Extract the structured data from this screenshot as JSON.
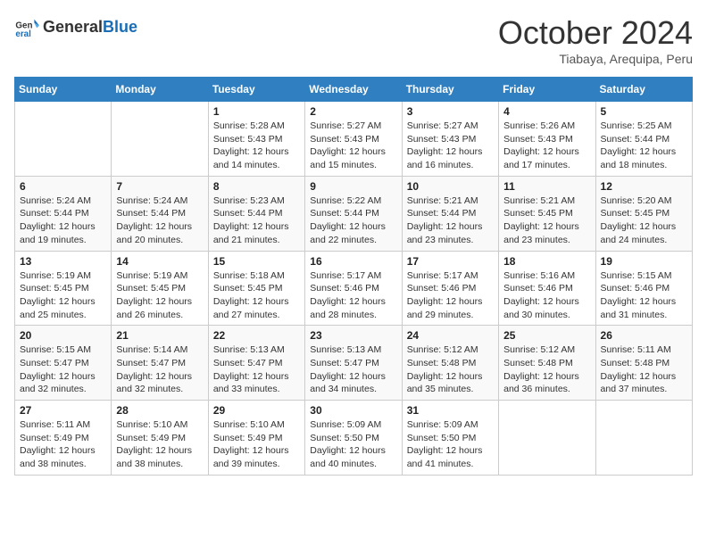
{
  "header": {
    "logo_general": "General",
    "logo_blue": "Blue",
    "title": "October 2024",
    "location": "Tiabaya, Arequipa, Peru"
  },
  "days_of_week": [
    "Sunday",
    "Monday",
    "Tuesday",
    "Wednesday",
    "Thursday",
    "Friday",
    "Saturday"
  ],
  "weeks": [
    [
      {
        "day": "",
        "info": ""
      },
      {
        "day": "",
        "info": ""
      },
      {
        "day": "1",
        "info": "Sunrise: 5:28 AM\nSunset: 5:43 PM\nDaylight: 12 hours and 14 minutes."
      },
      {
        "day": "2",
        "info": "Sunrise: 5:27 AM\nSunset: 5:43 PM\nDaylight: 12 hours and 15 minutes."
      },
      {
        "day": "3",
        "info": "Sunrise: 5:27 AM\nSunset: 5:43 PM\nDaylight: 12 hours and 16 minutes."
      },
      {
        "day": "4",
        "info": "Sunrise: 5:26 AM\nSunset: 5:43 PM\nDaylight: 12 hours and 17 minutes."
      },
      {
        "day": "5",
        "info": "Sunrise: 5:25 AM\nSunset: 5:44 PM\nDaylight: 12 hours and 18 minutes."
      }
    ],
    [
      {
        "day": "6",
        "info": "Sunrise: 5:24 AM\nSunset: 5:44 PM\nDaylight: 12 hours and 19 minutes."
      },
      {
        "day": "7",
        "info": "Sunrise: 5:24 AM\nSunset: 5:44 PM\nDaylight: 12 hours and 20 minutes."
      },
      {
        "day": "8",
        "info": "Sunrise: 5:23 AM\nSunset: 5:44 PM\nDaylight: 12 hours and 21 minutes."
      },
      {
        "day": "9",
        "info": "Sunrise: 5:22 AM\nSunset: 5:44 PM\nDaylight: 12 hours and 22 minutes."
      },
      {
        "day": "10",
        "info": "Sunrise: 5:21 AM\nSunset: 5:44 PM\nDaylight: 12 hours and 23 minutes."
      },
      {
        "day": "11",
        "info": "Sunrise: 5:21 AM\nSunset: 5:45 PM\nDaylight: 12 hours and 23 minutes."
      },
      {
        "day": "12",
        "info": "Sunrise: 5:20 AM\nSunset: 5:45 PM\nDaylight: 12 hours and 24 minutes."
      }
    ],
    [
      {
        "day": "13",
        "info": "Sunrise: 5:19 AM\nSunset: 5:45 PM\nDaylight: 12 hours and 25 minutes."
      },
      {
        "day": "14",
        "info": "Sunrise: 5:19 AM\nSunset: 5:45 PM\nDaylight: 12 hours and 26 minutes."
      },
      {
        "day": "15",
        "info": "Sunrise: 5:18 AM\nSunset: 5:45 PM\nDaylight: 12 hours and 27 minutes."
      },
      {
        "day": "16",
        "info": "Sunrise: 5:17 AM\nSunset: 5:46 PM\nDaylight: 12 hours and 28 minutes."
      },
      {
        "day": "17",
        "info": "Sunrise: 5:17 AM\nSunset: 5:46 PM\nDaylight: 12 hours and 29 minutes."
      },
      {
        "day": "18",
        "info": "Sunrise: 5:16 AM\nSunset: 5:46 PM\nDaylight: 12 hours and 30 minutes."
      },
      {
        "day": "19",
        "info": "Sunrise: 5:15 AM\nSunset: 5:46 PM\nDaylight: 12 hours and 31 minutes."
      }
    ],
    [
      {
        "day": "20",
        "info": "Sunrise: 5:15 AM\nSunset: 5:47 PM\nDaylight: 12 hours and 32 minutes."
      },
      {
        "day": "21",
        "info": "Sunrise: 5:14 AM\nSunset: 5:47 PM\nDaylight: 12 hours and 32 minutes."
      },
      {
        "day": "22",
        "info": "Sunrise: 5:13 AM\nSunset: 5:47 PM\nDaylight: 12 hours and 33 minutes."
      },
      {
        "day": "23",
        "info": "Sunrise: 5:13 AM\nSunset: 5:47 PM\nDaylight: 12 hours and 34 minutes."
      },
      {
        "day": "24",
        "info": "Sunrise: 5:12 AM\nSunset: 5:48 PM\nDaylight: 12 hours and 35 minutes."
      },
      {
        "day": "25",
        "info": "Sunrise: 5:12 AM\nSunset: 5:48 PM\nDaylight: 12 hours and 36 minutes."
      },
      {
        "day": "26",
        "info": "Sunrise: 5:11 AM\nSunset: 5:48 PM\nDaylight: 12 hours and 37 minutes."
      }
    ],
    [
      {
        "day": "27",
        "info": "Sunrise: 5:11 AM\nSunset: 5:49 PM\nDaylight: 12 hours and 38 minutes."
      },
      {
        "day": "28",
        "info": "Sunrise: 5:10 AM\nSunset: 5:49 PM\nDaylight: 12 hours and 38 minutes."
      },
      {
        "day": "29",
        "info": "Sunrise: 5:10 AM\nSunset: 5:49 PM\nDaylight: 12 hours and 39 minutes."
      },
      {
        "day": "30",
        "info": "Sunrise: 5:09 AM\nSunset: 5:50 PM\nDaylight: 12 hours and 40 minutes."
      },
      {
        "day": "31",
        "info": "Sunrise: 5:09 AM\nSunset: 5:50 PM\nDaylight: 12 hours and 41 minutes."
      },
      {
        "day": "",
        "info": ""
      },
      {
        "day": "",
        "info": ""
      }
    ]
  ]
}
